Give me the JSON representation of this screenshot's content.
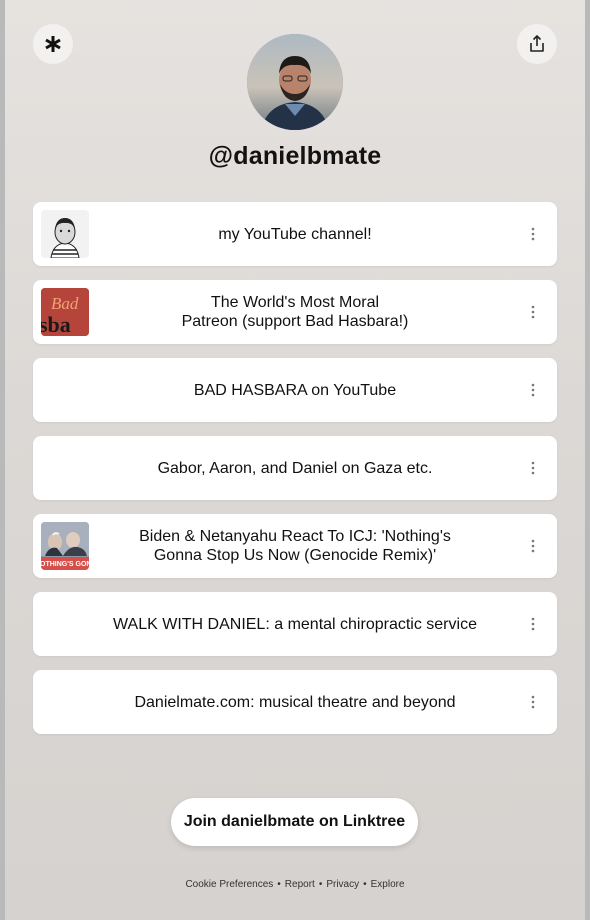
{
  "profile": {
    "username": "@danielbmate",
    "avatar_icon": "profile-photo"
  },
  "header": {
    "logo_icon": "linktree-asterisk-icon",
    "share_icon": "share-icon"
  },
  "links": [
    {
      "label": "my YouTube channel!",
      "thumbnail": "sketch-portrait"
    },
    {
      "label": "The World's Most Moral\nPatreon (support Bad Hasbara!)",
      "thumbnail": "bad-hasbara-logo",
      "thumb_text": "Bad\nsba"
    },
    {
      "label": "BAD HASBARA on YouTube",
      "thumbnail": null
    },
    {
      "label": "Gabor, Aaron, and Daniel on Gaza etc.",
      "thumbnail": null
    },
    {
      "label": "Biden & Netanyahu React To ICJ: 'Nothing's\nGonna Stop Us Now (Genocide Remix)'",
      "thumbnail": "video-still",
      "thumb_text": "OTHING'S GONNA STOP"
    },
    {
      "label": "WALK WITH DANIEL: a mental chiropractic service",
      "thumbnail": null
    },
    {
      "label": "Danielmate.com: musical theatre and beyond",
      "thumbnail": null
    }
  ],
  "join_button": {
    "label": "Join danielbmate on Linktree"
  },
  "footer": {
    "items": [
      "Cookie Preferences",
      "Report",
      "Privacy",
      "Explore"
    ],
    "separator": "•"
  },
  "colors": {
    "background": "#dcd8d5",
    "card": "#ffffff",
    "text": "#111111",
    "frame": "#b9b9b9"
  }
}
